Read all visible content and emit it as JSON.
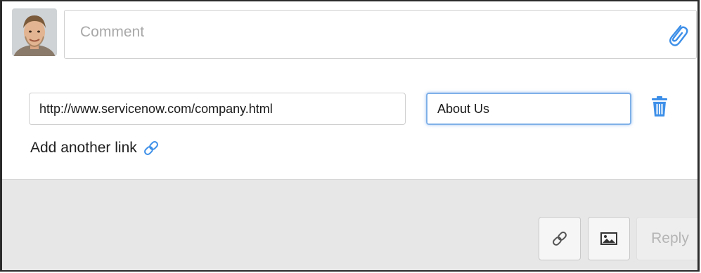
{
  "comment": {
    "placeholder": "Comment",
    "value": ""
  },
  "link_row": {
    "url_value": "http://www.servicenow.com/company.html",
    "title_value": "About Us"
  },
  "add_link_label": "Add another link",
  "footer": {
    "reply_label": "Reply"
  },
  "icons": {
    "avatar": "avatar",
    "attachment": "paperclip-icon",
    "delete": "trash-icon",
    "add_link": "link-icon",
    "insert_link": "link-icon",
    "insert_image": "image-icon"
  },
  "colors": {
    "accent_blue": "#3d8fe8",
    "focus_border": "#7fb0e8",
    "footer_bg": "#e7e7e7",
    "disabled_text": "#b5b5b5"
  }
}
